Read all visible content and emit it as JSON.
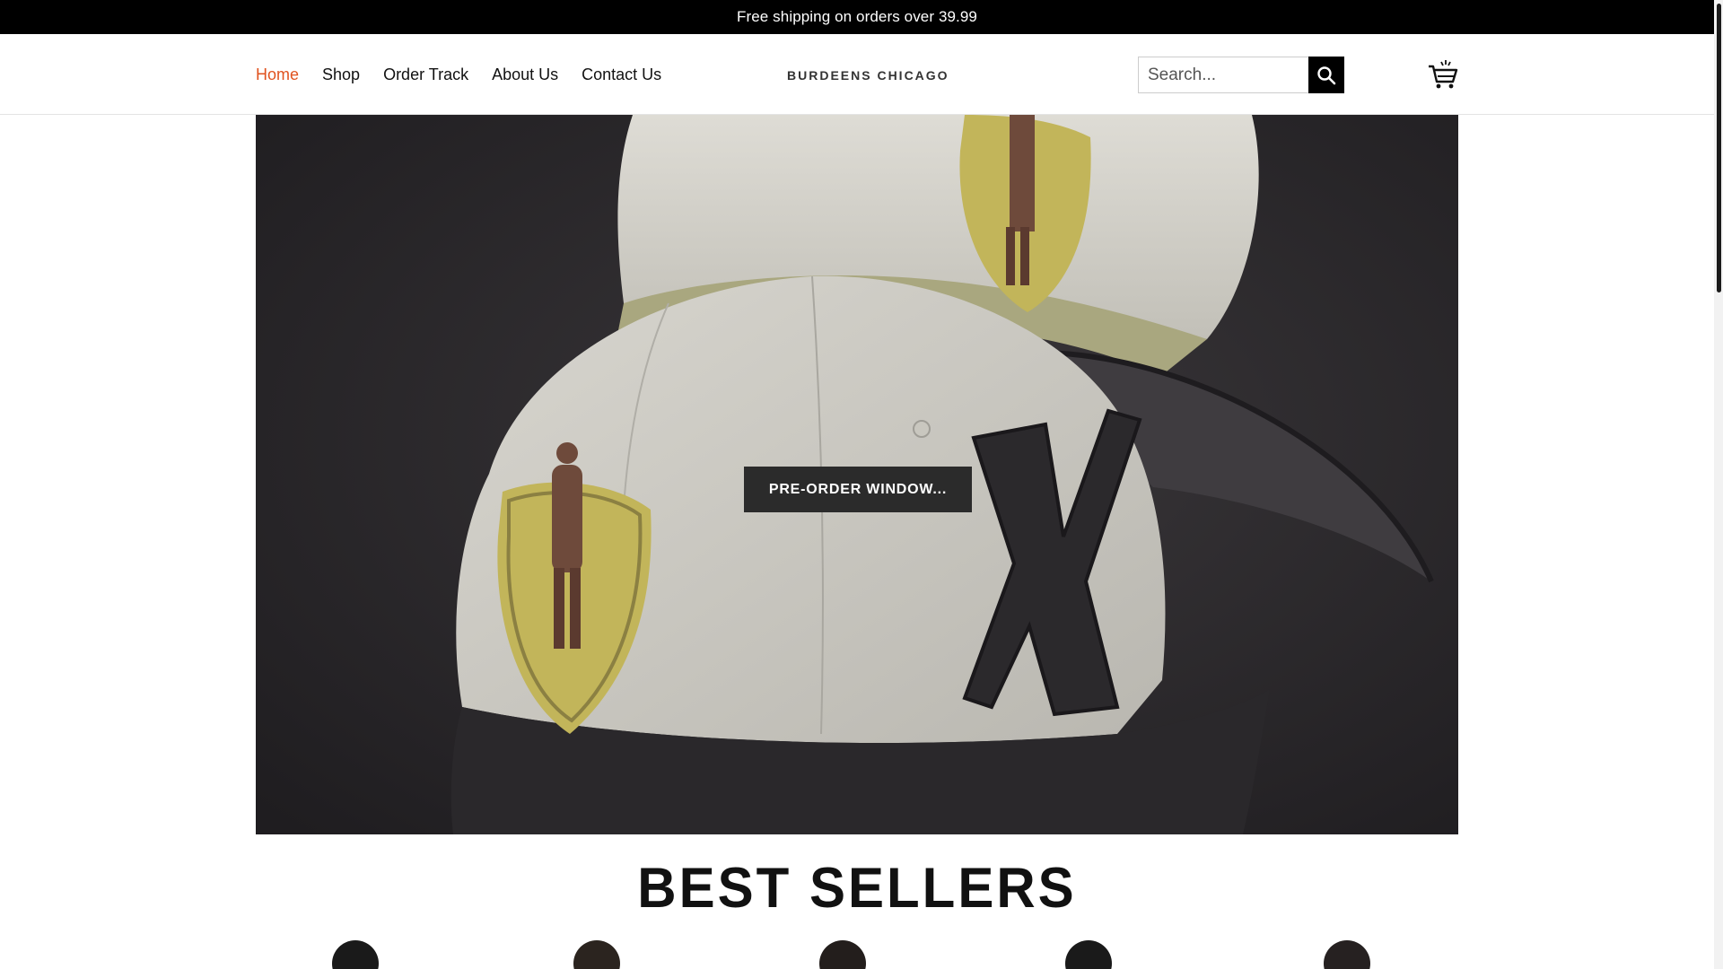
{
  "announcement": "Free shipping on orders over 39.99",
  "nav": {
    "items": [
      "Home",
      "Shop",
      "Order Track",
      "About Us",
      "Contact Us"
    ],
    "active": "Home"
  },
  "logo": "BURDEENS CHICAGO",
  "search": {
    "placeholder": "Search..."
  },
  "icons": {
    "search": "search-icon",
    "cart": "cart-icon"
  },
  "hero": {
    "button_label": "PRE-ORDER WINDOW..."
  },
  "best_sellers": {
    "title": "BEST SELLERS"
  },
  "colors": {
    "accent": "#e0531f",
    "header_bar": "#000000",
    "hero_bg": "#2f2c2f"
  }
}
